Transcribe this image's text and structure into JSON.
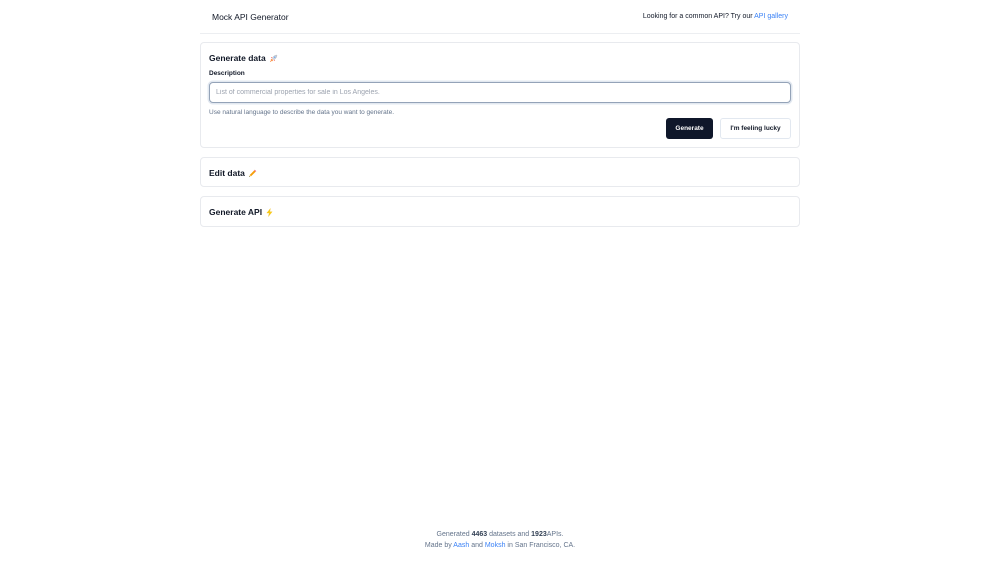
{
  "header": {
    "title": "Mock API Generator",
    "prompt_text": "Looking for a common API? Try our",
    "gallery_link": "API gallery"
  },
  "generate_section": {
    "title": "Generate data",
    "icon": "rocket-icon",
    "description_label": "Description",
    "description_value": "",
    "description_placeholder": "List of commercial properties for sale in Los Angeles.",
    "helper_text": "Use natural language to describe the data you want to generate.",
    "generate_button": "Generate",
    "lucky_button": "I'm feeling lucky"
  },
  "edit_section": {
    "title": "Edit data",
    "icon": "pencil-icon"
  },
  "api_section": {
    "title": "Generate API",
    "icon": "lightning-icon"
  },
  "footer": {
    "line1_prefix": "Generated",
    "datasets_count": "4463",
    "line1_middle": "datasets and",
    "apis_count": "1923",
    "line1_suffix": "APIs.",
    "line2_prefix": "Made by",
    "author1": "Aash",
    "line2_and": "and",
    "author2": "Moksh",
    "line2_suffix": "in San Francisco, CA."
  },
  "colors": {
    "accent_link": "#3b82f6",
    "primary_button": "#0f172a",
    "border": "#e8eaee"
  }
}
